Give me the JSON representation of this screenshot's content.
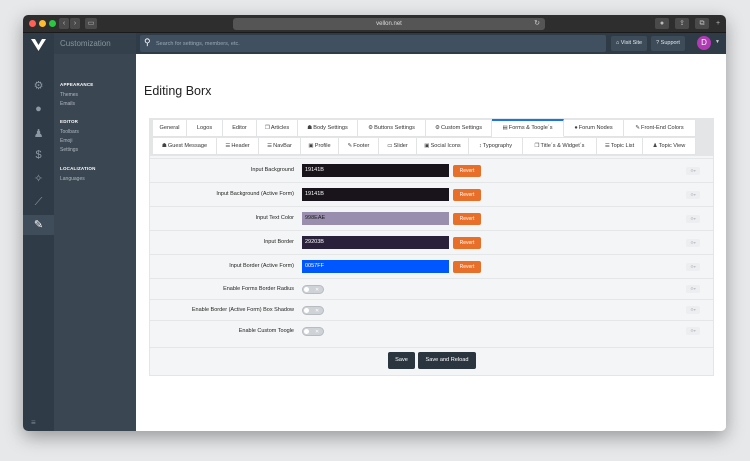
{
  "browser": {
    "url": "vellon.net"
  },
  "sidebar": {
    "title": "Customization",
    "sections": [
      {
        "heading": "APPEARANCE",
        "items": [
          "Themes",
          "Emails"
        ]
      },
      {
        "heading": "EDITOR",
        "items": [
          "Toolbars",
          "Emoji",
          "Settings"
        ]
      },
      {
        "heading": "LOCALIZATION",
        "items": [
          "Languages"
        ]
      }
    ]
  },
  "topbar": {
    "search_placeholder": "Search for settings, members, etc.",
    "visit_site": "Visit Site",
    "support": "Support",
    "avatar_initial": "D"
  },
  "page": {
    "title": "Editing Borx"
  },
  "tabs": {
    "row1": [
      "General",
      "Logos",
      "Editor",
      "Articles",
      "Body Settings",
      "Buttons Settings",
      "Custom Settings",
      "Forms & Toogle´s",
      "Forum Nodes",
      "Front-End Colors"
    ],
    "row2": [
      "Guest Message",
      "Header",
      "NavBar",
      "Profile",
      "Footer",
      "Slider",
      "Social Icons",
      "Typography",
      "Title´s & Widget´s",
      "Topic List",
      "Topic View"
    ],
    "active": "Forms & Toogle´s"
  },
  "settings": [
    {
      "label": "Input Background",
      "value": "19141B",
      "color": "#19141B",
      "text_color": "#ffffff"
    },
    {
      "label": "Input Background (Active Form)",
      "value": "19141B",
      "color": "#19141B",
      "text_color": "#ffffff"
    },
    {
      "label": "Input Text Color",
      "value": "998EAE",
      "color": "#998EAE",
      "text_color": "#1a1a1a"
    },
    {
      "label": "Input Border",
      "value": "29203B",
      "color": "#29203B",
      "text_color": "#ffffff"
    },
    {
      "label": "Input Border (Active Form)",
      "value": "0057FF",
      "color": "#0057FF",
      "text_color": "#ffffff"
    }
  ],
  "revert_label": "Revert",
  "toggles": [
    {
      "label": "Enable Forms Border Radius",
      "on": false
    },
    {
      "label": "Enable Border (Active Form) Box Shadow",
      "on": false
    },
    {
      "label": "Enable Custom Toogle",
      "on": false
    }
  ],
  "actions": {
    "save": "Save",
    "save_reload": "Save and Reload"
  }
}
